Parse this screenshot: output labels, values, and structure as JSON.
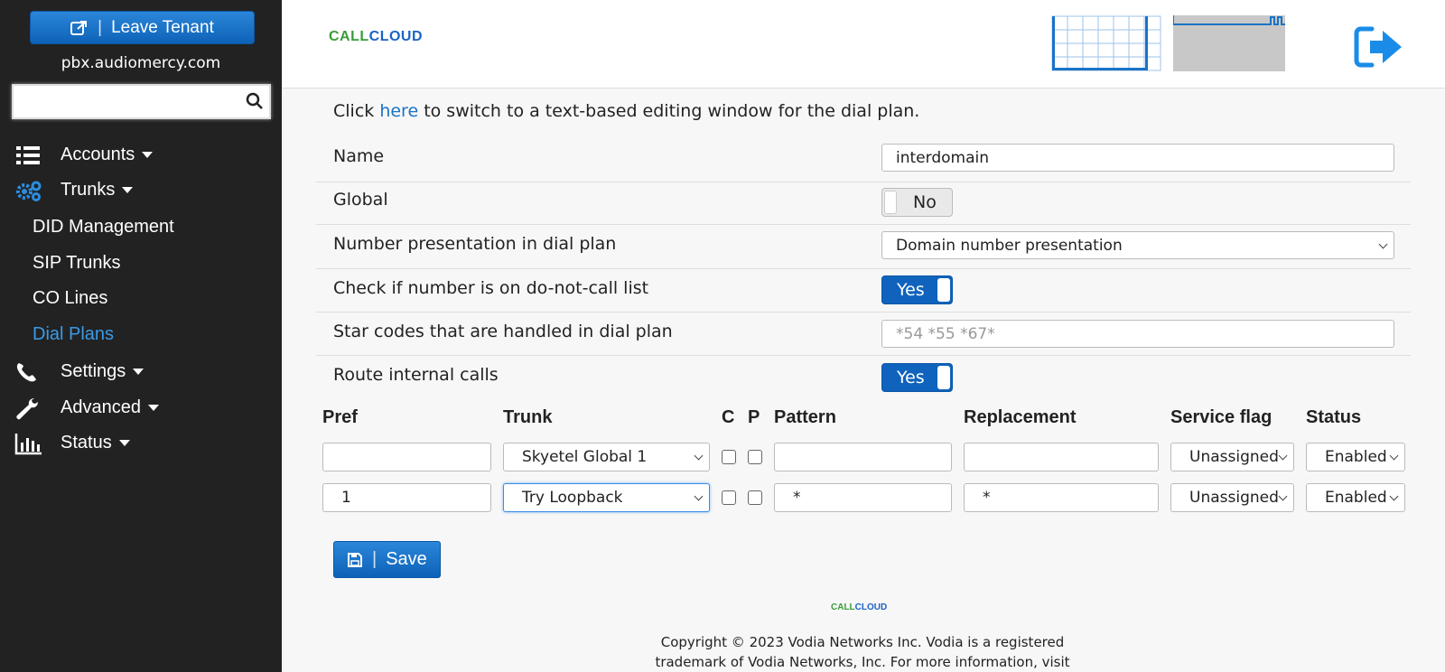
{
  "sidebar": {
    "leave_tenant": "Leave Tenant",
    "domain": "pbx.audiomercy.com",
    "search_placeholder": "",
    "items": [
      {
        "label": "Accounts"
      },
      {
        "label": "Trunks"
      },
      {
        "label": "Settings"
      },
      {
        "label": "Advanced"
      },
      {
        "label": "Status"
      }
    ],
    "trunk_sub": [
      "DID Management",
      "SIP Trunks",
      "CO Lines",
      "Dial Plans"
    ],
    "active_sub": "Dial Plans"
  },
  "header": {
    "logo_part1": "CALL",
    "logo_part2": "CLOUD"
  },
  "form": {
    "intro_before": "Click ",
    "intro_link": "here",
    "intro_after": " to switch to a text-based editing window for the dial plan.",
    "name_label": "Name",
    "name_value": "interdomain",
    "global_label": "Global",
    "global_value": "No",
    "presentation_label": "Number presentation in dial plan",
    "presentation_value": "Domain number presentation",
    "dnc_label": "Check if number is on do-not-call list",
    "dnc_value": "Yes",
    "star_label": "Star codes that are handled in dial plan",
    "star_placeholder": "*54 *55 *67*",
    "route_label": "Route internal calls",
    "route_value": "Yes"
  },
  "table": {
    "headers": {
      "pref": "Pref",
      "trunk": "Trunk",
      "c": "C",
      "p": "P",
      "pattern": "Pattern",
      "replacement": "Replacement",
      "service_flag": "Service flag",
      "status": "Status"
    },
    "rows": [
      {
        "pref": "",
        "trunk": "Skyetel Global 1",
        "pattern": "",
        "replacement": "",
        "service_flag": "Unassigned",
        "status": "Enabled"
      },
      {
        "pref": "1",
        "trunk": "Try Loopback",
        "pattern": "*",
        "replacement": "*",
        "service_flag": "Unassigned",
        "status": "Enabled"
      }
    ]
  },
  "save_label": "Save",
  "footer": {
    "logo_part1": "CALL",
    "logo_part2": "CLOUD",
    "copyright_line1": "Copyright © 2023 Vodia Networks Inc. Vodia is a registered",
    "copyright_line2": "trademark of Vodia Networks, Inc. For more information, visit"
  },
  "colors": {
    "sidebar_bg": "#222222",
    "accent_blue": "#0f63bd",
    "active_link": "#3a9be8",
    "logo_green": "#3a9c3a",
    "logo_blue": "#1b63c6"
  }
}
